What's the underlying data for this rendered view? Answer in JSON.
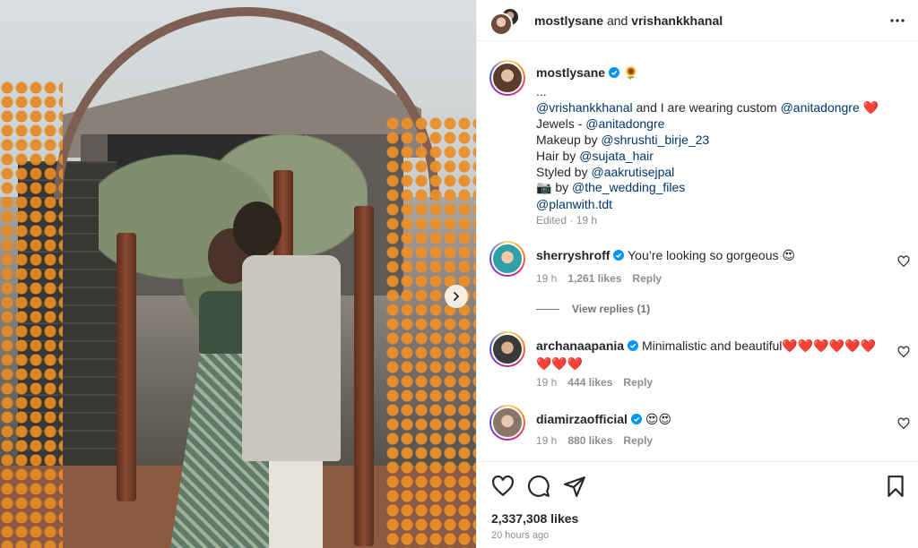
{
  "header": {
    "user1": "mostlysane",
    "and": "and",
    "user2": "vrishankkhanal",
    "more_icon": "more-horizontal-icon"
  },
  "caption": {
    "username": "mostlysane",
    "badge_emoji": "🌻",
    "ellipsis": "...",
    "line1_mention": "@vrishankkhanal",
    "line1_text": " and I are wearing custom ",
    "line1_mention2": "@anitadongre",
    "line1_emoji": "❤️",
    "line2_text": "Jewels - ",
    "line2_mention": "@anitadongre",
    "line3_text": "Makeup by ",
    "line3_mention": "@shrushti_birje_23",
    "line4_text": "Hair by ",
    "line4_mention": "@sujata_hair",
    "line5_text": "Styled by ",
    "line5_mention": "@aakrutisejpal",
    "line6_emoji": "📷",
    "line6_text": " by ",
    "line6_mention": "@the_wedding_files",
    "line7_mention": "@planwith.tdt",
    "meta": "Edited · 19 h"
  },
  "comments": [
    {
      "username": "sherryshroff",
      "text": "You’re looking so gorgeous",
      "emoji": "😍",
      "time": "19 h",
      "likes": "1,261 likes",
      "reply": "Reply"
    },
    {
      "username": "archanaapania",
      "text": "Minimalistic and beautiful",
      "emoji": "❤️❤️❤️❤️❤️❤️",
      "emoji2": "❤️❤️❤️",
      "time": "19 h",
      "likes": "444 likes",
      "reply": "Reply"
    },
    {
      "username": "diamirzaofficial",
      "text": "",
      "emoji": "😍😍",
      "time": "19 h",
      "likes": "880 likes",
      "reply": "Reply"
    }
  ],
  "view_replies": "View replies (1)",
  "actions": {
    "like_icon": "heart-icon",
    "comment_icon": "comment-icon",
    "share_icon": "send-icon",
    "save_icon": "bookmark-icon",
    "likes": "2,337,308 likes",
    "time_ago": "20 hours ago"
  },
  "colors": {
    "mention": "#00376b",
    "verified": "#0095f6",
    "muted": "#8e8e8e"
  }
}
